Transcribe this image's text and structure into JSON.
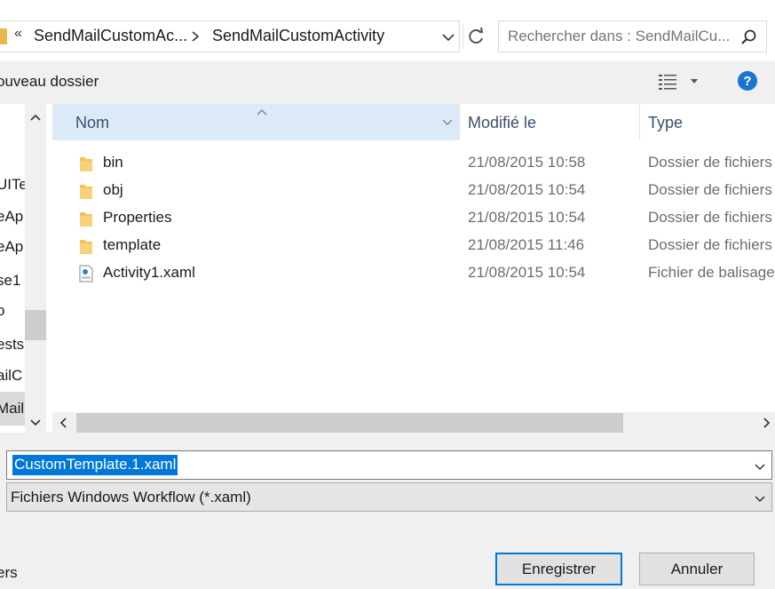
{
  "address": {
    "overflow_label": "«",
    "crumbs": [
      "SendMailCustomAc...",
      "SendMailCustomActivity"
    ]
  },
  "search": {
    "placeholder": "Rechercher dans : SendMailCu..."
  },
  "toolbar": {
    "new_folder_label": "ouveau dossier"
  },
  "nav": {
    "items": [
      "UITe",
      "eAp",
      "eAp",
      "se1",
      "o",
      "ests",
      "ailC",
      "Mail"
    ]
  },
  "columns": {
    "name": "Nom",
    "modified": "Modifié le",
    "type": "Type"
  },
  "files": [
    {
      "name": "bin",
      "modified": "21/08/2015 10:58",
      "type": "Dossier de fichiers",
      "icon": "folder-icon"
    },
    {
      "name": "obj",
      "modified": "21/08/2015 10:54",
      "type": "Dossier de fichiers",
      "icon": "folder-icon"
    },
    {
      "name": "Properties",
      "modified": "21/08/2015 10:54",
      "type": "Dossier de fichiers",
      "icon": "folder-icon"
    },
    {
      "name": "template",
      "modified": "21/08/2015 11:46",
      "type": "Dossier de fichiers",
      "icon": "folder-icon"
    },
    {
      "name": "Activity1.xaml",
      "modified": "21/08/2015 10:54",
      "type": "Fichier de balisage",
      "icon": "xaml-file-icon"
    }
  ],
  "filename": {
    "value": "CustomTemplate.1.xaml"
  },
  "filetype": {
    "value": "Fichiers Windows Workflow (*.xaml)"
  },
  "footer": {
    "hide_folders_label": "ers",
    "save_label": "Enregistrer",
    "cancel_label": "Annuler"
  },
  "colors": {
    "accent": "#0078d7",
    "header_bg": "#dceaf7",
    "folder": "#f2c55c",
    "help": "#1874cd"
  }
}
